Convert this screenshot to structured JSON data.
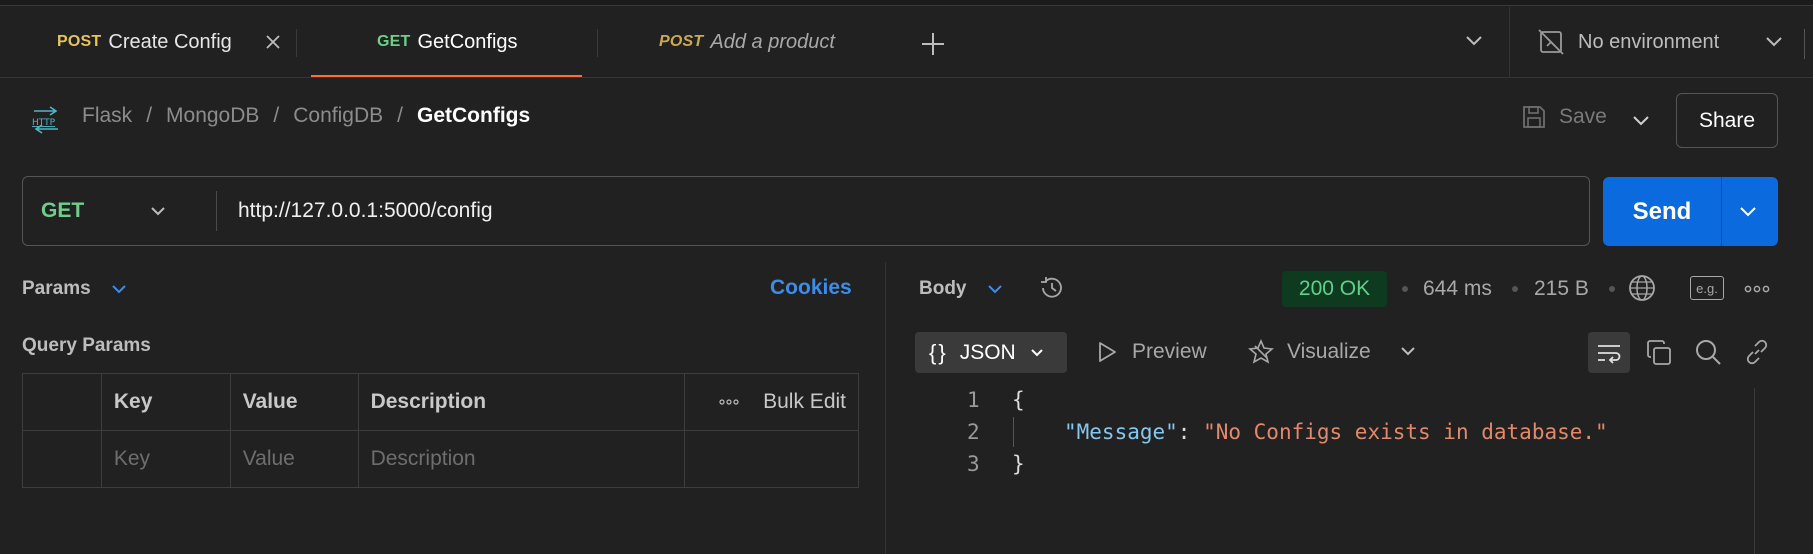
{
  "tabs": [
    {
      "method": "POST",
      "name": "Create Config",
      "active": false
    },
    {
      "method": "GET",
      "name": "GetConfigs",
      "active": true
    },
    {
      "method": "POST",
      "name": "Add a product",
      "active": false
    }
  ],
  "environment": {
    "label": "No environment"
  },
  "breadcrumb": {
    "items": [
      "Flask",
      "MongoDB",
      "ConfigDB"
    ],
    "separator": "/",
    "current": "GetConfigs"
  },
  "toolbar": {
    "save_label": "Save",
    "share_label": "Share"
  },
  "request": {
    "method": "GET",
    "url": "http://127.0.0.1:5000/config",
    "send_label": "Send"
  },
  "params": {
    "tab_label": "Params",
    "cookies_label": "Cookies",
    "section_title": "Query Params",
    "columns": [
      "Key",
      "Value",
      "Description"
    ],
    "bulk_edit_label": "Bulk Edit",
    "placeholders": [
      "Key",
      "Value",
      "Description"
    ]
  },
  "response": {
    "tab_label": "Body",
    "status": "200 OK",
    "time": "644 ms",
    "size": "215 B",
    "format_label": "JSON",
    "preview_label": "Preview",
    "visualize_label": "Visualize",
    "eg_label": "e.g.",
    "lines": [
      {
        "num": "1",
        "text": "{"
      },
      {
        "num": "2",
        "key": "\"Message\"",
        "value": "\"No Configs exists in database.\""
      },
      {
        "num": "3",
        "text": "}"
      }
    ]
  },
  "colors": {
    "accent": "#ff6c37",
    "send": "#0b6bde",
    "get": "#6fcf8a",
    "post": "#e8c25a",
    "status_ok": "#5fd18a",
    "link": "#3d8ce8"
  }
}
